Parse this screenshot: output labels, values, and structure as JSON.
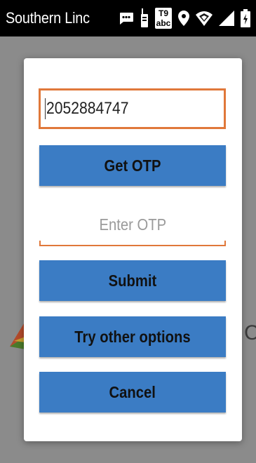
{
  "status_bar": {
    "carrier": "Southern Linc",
    "icons": [
      "message-icon",
      "walkie-talkie-icon",
      "t9-abc-icon",
      "location-icon",
      "wifi-icon",
      "signal-icon",
      "battery-icon"
    ],
    "t9_top": "T9",
    "t9_bottom": "abc"
  },
  "background": {
    "partial_letter": "C"
  },
  "dialog": {
    "phone_value": "2052884747",
    "get_otp_label": "Get OTP",
    "otp_placeholder": "Enter OTP",
    "submit_label": "Submit",
    "try_other_label": "Try other options",
    "cancel_label": "Cancel"
  },
  "colors": {
    "accent": "#e0783a",
    "button": "#3b7cc4",
    "overlay": "#8b8b8b"
  }
}
